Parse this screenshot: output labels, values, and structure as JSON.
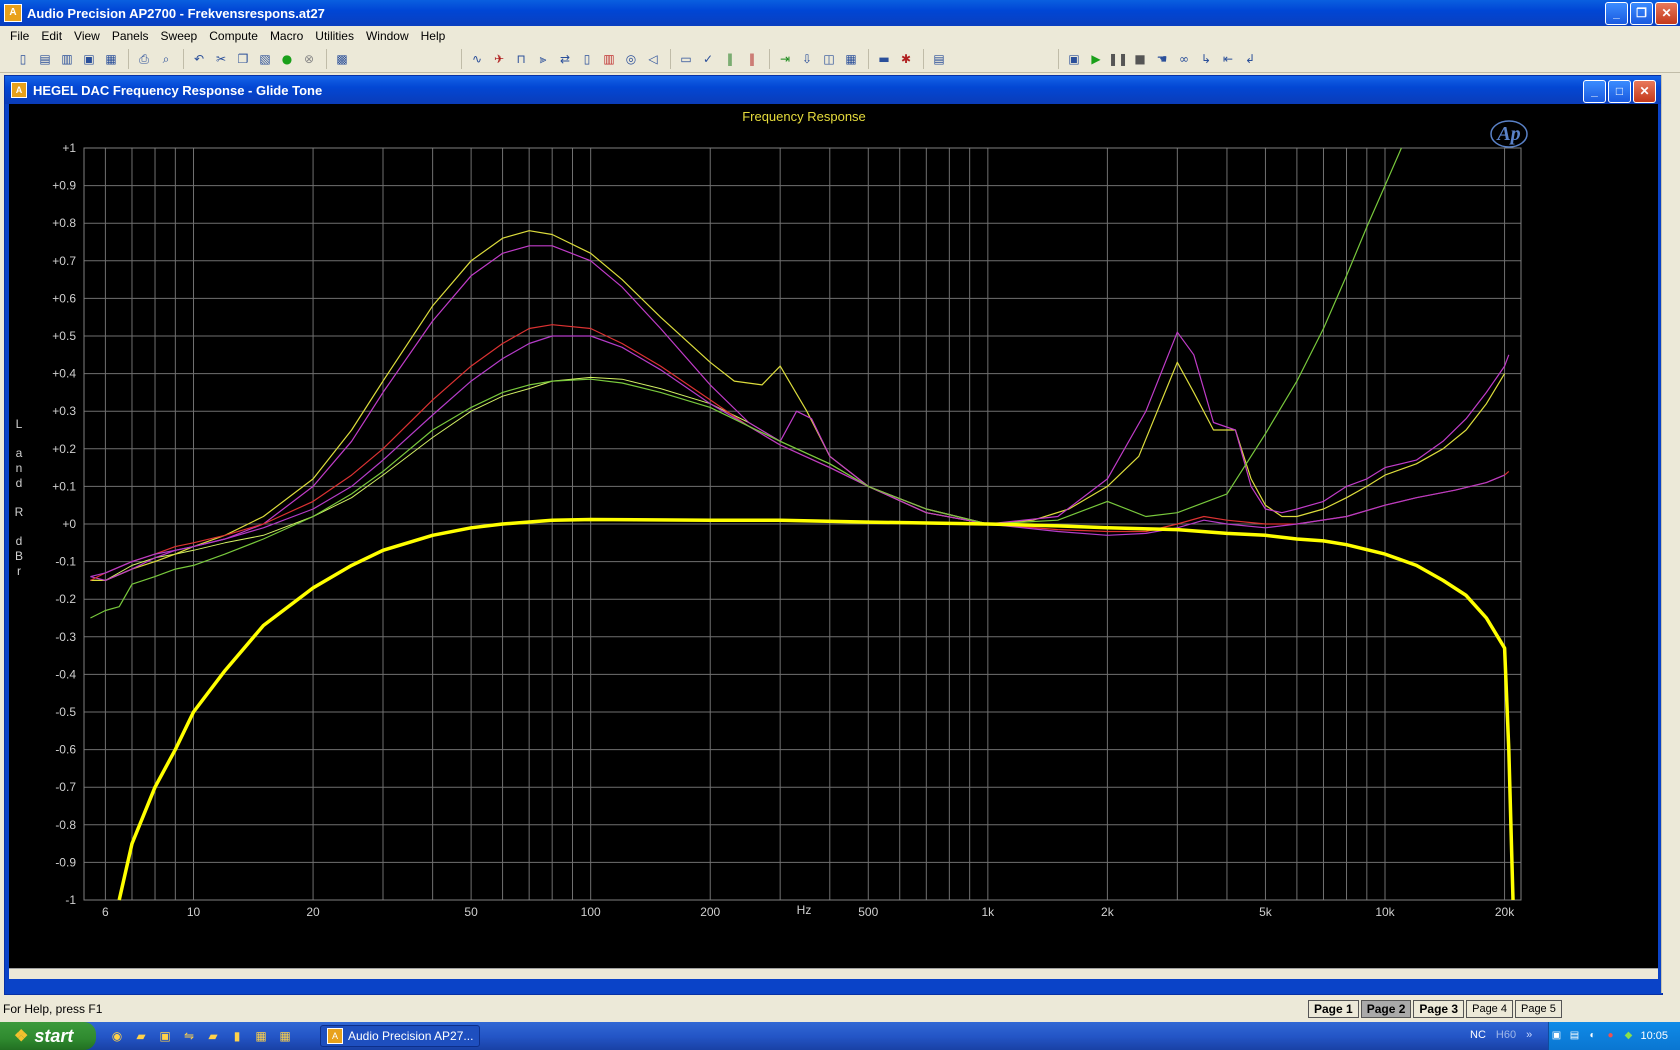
{
  "app": {
    "title": "Audio Precision AP2700 - Frekvensrespons.at27",
    "icon": "audio-precision-app-icon"
  },
  "menu": [
    "File",
    "Edit",
    "View",
    "Panels",
    "Sweep",
    "Compute",
    "Macro",
    "Utilities",
    "Window",
    "Help"
  ],
  "toolbar": {
    "icons": [
      "new-icon",
      "open-icon",
      "open-test-icon",
      "save-icon",
      "save-all-icon",
      "print-icon",
      "print-preview-icon",
      "undo-icon",
      "cut-icon",
      "copy-icon",
      "paste-icon",
      "go-icon",
      "stop-icon",
      "settings-icon",
      "graph-icon",
      "analyzer-icon",
      "generator-icon",
      "filter-icon",
      "sweep-icon",
      "settling-icon",
      "bargraph-icon",
      "meter-icon",
      "speaker-icon",
      "dcx-icon",
      "check-icon",
      "panel-icon",
      "equalizer-icon",
      "import-icon",
      "export-icon",
      "chart-icon",
      "table-icon",
      "monitor-icon",
      "signal-icon",
      "notes-icon",
      "page-icon",
      "play-icon",
      "pause-icon",
      "stop-square-icon",
      "hand-icon",
      "glasses-icon",
      "step-icon",
      "record-icon",
      "cursor-icon"
    ]
  },
  "child_window": {
    "title": "HEGEL  DAC Frequency Response - Glide Tone"
  },
  "chart_data": {
    "type": "line",
    "title": "Frequency Response",
    "xlabel": "Hz",
    "ylabel": "L and R dBr",
    "xscale": "log",
    "xlim": [
      5.3,
      22000
    ],
    "ylim": [
      -1,
      1
    ],
    "x_ticks": [
      6,
      10,
      20,
      50,
      100,
      200,
      500,
      1000,
      2000,
      5000,
      10000,
      20000
    ],
    "x_tick_labels": [
      "6",
      "10",
      "20",
      "50",
      "100",
      "200",
      "500",
      "1k",
      "2k",
      "5k",
      "10k",
      "20k"
    ],
    "y_ticks": [
      1,
      0.9,
      0.8,
      0.7,
      0.6,
      0.5,
      0.4,
      0.3,
      0.2,
      0.1,
      0,
      -0.1,
      -0.2,
      -0.3,
      -0.4,
      -0.5,
      -0.6,
      -0.7,
      -0.8,
      -0.9,
      -1
    ],
    "y_tick_labels": [
      "+1",
      "+0.9",
      "+0.8",
      "+0.7",
      "+0.6",
      "+0.5",
      "+0.4",
      "+0.3",
      "+0.2",
      "+0.1",
      "+0",
      "-0.1",
      "-0.2",
      "-0.3",
      "-0.4",
      "-0.5",
      "-0.6",
      "-0.7",
      "-0.8",
      "-0.9",
      "-1"
    ],
    "grid": true,
    "logo": "Ap",
    "series": [
      {
        "color": "#ffff00",
        "width": 3.5,
        "points": [
          [
            6.5,
            -1.0
          ],
          [
            7,
            -0.85
          ],
          [
            8,
            -0.7
          ],
          [
            9,
            -0.6
          ],
          [
            10,
            -0.5
          ],
          [
            12,
            -0.39
          ],
          [
            15,
            -0.27
          ],
          [
            20,
            -0.17
          ],
          [
            25,
            -0.11
          ],
          [
            30,
            -0.07
          ],
          [
            40,
            -0.03
          ],
          [
            50,
            -0.01
          ],
          [
            60,
            0.0
          ],
          [
            80,
            0.01
          ],
          [
            100,
            0.012
          ],
          [
            200,
            0.01
          ],
          [
            300,
            0.01
          ],
          [
            500,
            0.005
          ],
          [
            1000,
            0.0
          ],
          [
            1500,
            -0.005
          ],
          [
            2000,
            -0.01
          ],
          [
            3000,
            -0.015
          ],
          [
            4000,
            -0.025
          ],
          [
            5000,
            -0.03
          ],
          [
            6000,
            -0.04
          ],
          [
            7000,
            -0.045
          ],
          [
            8000,
            -0.055
          ],
          [
            10000,
            -0.08
          ],
          [
            12000,
            -0.11
          ],
          [
            14000,
            -0.15
          ],
          [
            16000,
            -0.19
          ],
          [
            18000,
            -0.25
          ],
          [
            20000,
            -0.33
          ],
          [
            20500,
            -0.6
          ],
          [
            21000,
            -1.0
          ]
        ]
      },
      {
        "color": "#dcdc3c",
        "width": 1.2,
        "points": [
          [
            5.5,
            -0.15
          ],
          [
            6,
            -0.15
          ],
          [
            7,
            -0.12
          ],
          [
            8,
            -0.1
          ],
          [
            9,
            -0.08
          ],
          [
            10,
            -0.06
          ],
          [
            12,
            -0.03
          ],
          [
            15,
            0.02
          ],
          [
            20,
            0.12
          ],
          [
            25,
            0.25
          ],
          [
            30,
            0.38
          ],
          [
            40,
            0.58
          ],
          [
            50,
            0.7
          ],
          [
            60,
            0.76
          ],
          [
            70,
            0.78
          ],
          [
            80,
            0.77
          ],
          [
            100,
            0.72
          ],
          [
            120,
            0.65
          ],
          [
            150,
            0.55
          ],
          [
            200,
            0.43
          ],
          [
            230,
            0.38
          ],
          [
            270,
            0.37
          ],
          [
            300,
            0.42
          ],
          [
            350,
            0.3
          ],
          [
            400,
            0.18
          ],
          [
            500,
            0.1
          ],
          [
            700,
            0.03
          ],
          [
            1000,
            0.0
          ],
          [
            1300,
            0.01
          ],
          [
            1600,
            0.04
          ],
          [
            2000,
            0.1
          ],
          [
            2400,
            0.18
          ],
          [
            3000,
            0.43
          ],
          [
            3300,
            0.35
          ],
          [
            3700,
            0.25
          ],
          [
            4200,
            0.25
          ],
          [
            4600,
            0.12
          ],
          [
            5000,
            0.05
          ],
          [
            5500,
            0.02
          ],
          [
            6000,
            0.02
          ],
          [
            7000,
            0.04
          ],
          [
            8000,
            0.07
          ],
          [
            9000,
            0.1
          ],
          [
            10000,
            0.13
          ],
          [
            12000,
            0.16
          ],
          [
            14000,
            0.2
          ],
          [
            16000,
            0.25
          ],
          [
            18000,
            0.32
          ],
          [
            20000,
            0.4
          ]
        ]
      },
      {
        "color": "#c03cc8",
        "width": 1.2,
        "points": [
          [
            5.5,
            -0.14
          ],
          [
            6,
            -0.15
          ],
          [
            7,
            -0.12
          ],
          [
            8,
            -0.09
          ],
          [
            9,
            -0.07
          ],
          [
            10,
            -0.06
          ],
          [
            12,
            -0.04
          ],
          [
            15,
            0.0
          ],
          [
            20,
            0.1
          ],
          [
            25,
            0.22
          ],
          [
            30,
            0.35
          ],
          [
            40,
            0.54
          ],
          [
            50,
            0.66
          ],
          [
            60,
            0.72
          ],
          [
            70,
            0.74
          ],
          [
            80,
            0.74
          ],
          [
            100,
            0.7
          ],
          [
            120,
            0.63
          ],
          [
            150,
            0.52
          ],
          [
            200,
            0.37
          ],
          [
            250,
            0.27
          ],
          [
            300,
            0.22
          ],
          [
            330,
            0.3
          ],
          [
            360,
            0.28
          ],
          [
            400,
            0.18
          ],
          [
            500,
            0.1
          ],
          [
            700,
            0.03
          ],
          [
            1000,
            0.0
          ],
          [
            1500,
            0.02
          ],
          [
            2000,
            0.12
          ],
          [
            2500,
            0.3
          ],
          [
            3000,
            0.51
          ],
          [
            3300,
            0.45
          ],
          [
            3700,
            0.27
          ],
          [
            4200,
            0.25
          ],
          [
            4600,
            0.1
          ],
          [
            5000,
            0.04
          ],
          [
            5500,
            0.03
          ],
          [
            6000,
            0.04
          ],
          [
            7000,
            0.06
          ],
          [
            8000,
            0.1
          ],
          [
            9000,
            0.12
          ],
          [
            10000,
            0.15
          ],
          [
            12000,
            0.17
          ],
          [
            14000,
            0.22
          ],
          [
            16000,
            0.28
          ],
          [
            18000,
            0.35
          ],
          [
            20000,
            0.42
          ],
          [
            20500,
            0.45
          ]
        ]
      },
      {
        "color": "#dc3232",
        "width": 1.2,
        "points": [
          [
            5.5,
            -0.15
          ],
          [
            6,
            -0.13
          ],
          [
            7,
            -0.1
          ],
          [
            8,
            -0.08
          ],
          [
            9,
            -0.06
          ],
          [
            10,
            -0.05
          ],
          [
            12,
            -0.03
          ],
          [
            15,
            0.0
          ],
          [
            20,
            0.06
          ],
          [
            25,
            0.13
          ],
          [
            30,
            0.2
          ],
          [
            40,
            0.33
          ],
          [
            50,
            0.42
          ],
          [
            60,
            0.48
          ],
          [
            70,
            0.52
          ],
          [
            80,
            0.53
          ],
          [
            100,
            0.52
          ],
          [
            120,
            0.48
          ],
          [
            150,
            0.42
          ],
          [
            200,
            0.33
          ],
          [
            250,
            0.26
          ],
          [
            300,
            0.21
          ],
          [
            400,
            0.15
          ],
          [
            500,
            0.1
          ],
          [
            700,
            0.04
          ],
          [
            1000,
            0.0
          ],
          [
            1500,
            -0.015
          ],
          [
            2000,
            -0.02
          ],
          [
            2500,
            -0.02
          ],
          [
            3000,
            0.0
          ],
          [
            3500,
            0.02
          ],
          [
            4000,
            0.01
          ],
          [
            5000,
            0.0
          ],
          [
            6000,
            0.0
          ],
          [
            8000,
            0.02
          ],
          [
            10000,
            0.05
          ],
          [
            12000,
            0.07
          ],
          [
            15000,
            0.09
          ],
          [
            18000,
            0.11
          ],
          [
            20000,
            0.13
          ],
          [
            20500,
            0.14
          ]
        ]
      },
      {
        "color": "#b43cc8",
        "width": 1.2,
        "points": [
          [
            5.5,
            -0.14
          ],
          [
            6,
            -0.13
          ],
          [
            7,
            -0.1
          ],
          [
            8,
            -0.08
          ],
          [
            9,
            -0.07
          ],
          [
            10,
            -0.06
          ],
          [
            12,
            -0.04
          ],
          [
            15,
            -0.01
          ],
          [
            20,
            0.04
          ],
          [
            25,
            0.1
          ],
          [
            30,
            0.17
          ],
          [
            40,
            0.29
          ],
          [
            50,
            0.38
          ],
          [
            60,
            0.44
          ],
          [
            70,
            0.48
          ],
          [
            80,
            0.5
          ],
          [
            100,
            0.5
          ],
          [
            120,
            0.47
          ],
          [
            150,
            0.41
          ],
          [
            200,
            0.32
          ],
          [
            250,
            0.26
          ],
          [
            300,
            0.21
          ],
          [
            400,
            0.15
          ],
          [
            500,
            0.1
          ],
          [
            700,
            0.04
          ],
          [
            1000,
            0.0
          ],
          [
            1500,
            -0.02
          ],
          [
            2000,
            -0.03
          ],
          [
            2500,
            -0.025
          ],
          [
            3000,
            -0.01
          ],
          [
            3500,
            0.01
          ],
          [
            4000,
            0.0
          ],
          [
            5000,
            -0.01
          ],
          [
            6000,
            0.0
          ],
          [
            8000,
            0.02
          ],
          [
            10000,
            0.05
          ],
          [
            12000,
            0.07
          ],
          [
            15000,
            0.09
          ],
          [
            18000,
            0.11
          ],
          [
            20000,
            0.13
          ]
        ]
      },
      {
        "color": "#78c83c",
        "width": 1.2,
        "points": [
          [
            5.5,
            -0.25
          ],
          [
            6,
            -0.23
          ],
          [
            6.5,
            -0.22
          ],
          [
            7,
            -0.16
          ],
          [
            8,
            -0.14
          ],
          [
            9,
            -0.12
          ],
          [
            10,
            -0.11
          ],
          [
            12,
            -0.08
          ],
          [
            15,
            -0.04
          ],
          [
            20,
            0.02
          ],
          [
            25,
            0.08
          ],
          [
            30,
            0.14
          ],
          [
            40,
            0.25
          ],
          [
            50,
            0.31
          ],
          [
            60,
            0.35
          ],
          [
            70,
            0.37
          ],
          [
            80,
            0.38
          ],
          [
            100,
            0.385
          ],
          [
            120,
            0.375
          ],
          [
            150,
            0.35
          ],
          [
            200,
            0.31
          ],
          [
            250,
            0.26
          ],
          [
            300,
            0.22
          ],
          [
            400,
            0.16
          ],
          [
            500,
            0.1
          ],
          [
            700,
            0.04
          ],
          [
            1000,
            0.0
          ],
          [
            1500,
            0.01
          ],
          [
            2000,
            0.06
          ],
          [
            2500,
            0.02
          ],
          [
            3000,
            0.03
          ],
          [
            4000,
            0.08
          ],
          [
            5000,
            0.24
          ],
          [
            6000,
            0.38
          ],
          [
            7000,
            0.52
          ],
          [
            8000,
            0.66
          ],
          [
            9000,
            0.79
          ],
          [
            10000,
            0.9
          ],
          [
            11000,
            1.0
          ]
        ]
      },
      {
        "color": "#d2f064",
        "width": 1.0,
        "points": [
          [
            5.5,
            -0.15
          ],
          [
            6,
            -0.15
          ],
          [
            7,
            -0.11
          ],
          [
            8,
            -0.09
          ],
          [
            9,
            -0.08
          ],
          [
            10,
            -0.07
          ],
          [
            12,
            -0.05
          ],
          [
            15,
            -0.03
          ],
          [
            20,
            0.02
          ],
          [
            25,
            0.07
          ],
          [
            30,
            0.13
          ],
          [
            40,
            0.23
          ],
          [
            50,
            0.3
          ],
          [
            60,
            0.34
          ],
          [
            70,
            0.36
          ],
          [
            80,
            0.38
          ],
          [
            100,
            0.39
          ],
          [
            120,
            0.385
          ],
          [
            150,
            0.36
          ],
          [
            200,
            0.32
          ],
          [
            250,
            0.27
          ],
          [
            300,
            0.22
          ],
          [
            400,
            0.16
          ],
          [
            500,
            0.1
          ],
          [
            700,
            0.04
          ],
          [
            1000,
            0.0
          ]
        ]
      }
    ]
  },
  "status": {
    "help": "For Help, press F1",
    "pages": [
      "Page 1",
      "Page 2",
      "Page 3",
      "Page 4",
      "Page 5"
    ],
    "active_page": "Page 2"
  },
  "taskbar": {
    "start": "start",
    "task": "Audio Precision AP27...",
    "nc": "NC",
    "h60": "H60",
    "time": "10:05"
  }
}
